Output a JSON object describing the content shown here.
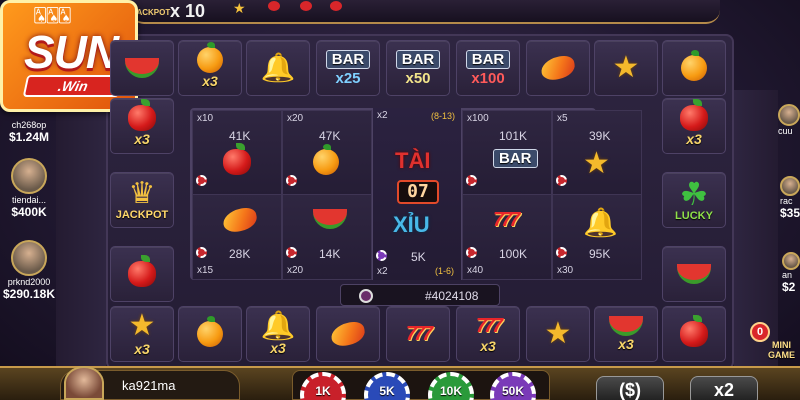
{
  "top": {
    "jackpot_label": "JACKPOT",
    "jackpot_multiplier": "x 10"
  },
  "logo": {
    "brand": "SUN",
    "ribbon": ".Win"
  },
  "board": {
    "top_row": [
      {
        "type": "melon",
        "label": ""
      },
      {
        "type": "orange",
        "label": "x3"
      },
      {
        "type": "bell",
        "label": ""
      },
      {
        "type": "bar",
        "word": "BAR",
        "mult": "x25",
        "mult_color": "#7fd0ff"
      },
      {
        "type": "bar",
        "word": "BAR",
        "mult": "x50",
        "mult_color": "#f2e48a"
      },
      {
        "type": "bar",
        "word": "BAR",
        "mult": "x100",
        "mult_color": "#ff5a5a"
      },
      {
        "type": "mango",
        "label": ""
      },
      {
        "type": "star",
        "label": ""
      },
      {
        "type": "orange",
        "label": ""
      }
    ],
    "bottom_row": [
      {
        "type": "star",
        "label": "x3"
      },
      {
        "type": "orange",
        "label": ""
      },
      {
        "type": "bell",
        "label": "x3"
      },
      {
        "type": "mango",
        "label": ""
      },
      {
        "type": "seven",
        "label": ""
      },
      {
        "type": "seven",
        "label": "x3"
      },
      {
        "type": "star",
        "label": ""
      },
      {
        "type": "melon",
        "label": "x3"
      },
      {
        "type": "apple",
        "label": ""
      }
    ],
    "left_col": [
      {
        "type": "apple",
        "label": "x3"
      },
      {
        "type": "jackpot",
        "label": "JACKPOT"
      },
      {
        "type": "apple",
        "label": ""
      }
    ],
    "right_col": [
      {
        "type": "apple",
        "label": "x3"
      },
      {
        "type": "lucky",
        "label": "LUCKY"
      },
      {
        "type": "melon",
        "label": ""
      }
    ]
  },
  "bets": {
    "top": [
      {
        "mult": "x10",
        "amount": "41K",
        "symbol": "apple"
      },
      {
        "mult": "x20",
        "amount": "47K",
        "symbol": "orange"
      },
      {
        "mult": "x100",
        "amount": "101K",
        "symbol": "bar"
      },
      {
        "mult": "x5",
        "amount": "39K",
        "symbol": "star"
      }
    ],
    "bottom": [
      {
        "mult": "x15",
        "amount": "28K",
        "symbol": "mango"
      },
      {
        "mult": "x20",
        "amount": "14K",
        "symbol": "melon"
      },
      {
        "mult": "x40",
        "amount": "100K",
        "symbol": "seven"
      },
      {
        "mult": "x30",
        "amount": "95K",
        "symbol": "bell"
      }
    ],
    "center": {
      "top_mult": "x2",
      "top_range": "(8-13)",
      "tai": "TÀI",
      "counter": "07",
      "xiu": "XỈU",
      "bottom_amount": "5K",
      "bottom_mult": "x2",
      "bottom_range": "(1-6)"
    },
    "bar_label": "BAR"
  },
  "round": {
    "id": "#4024108"
  },
  "players_left": [
    {
      "name": "ch268op",
      "amount": "$1.24M"
    },
    {
      "name": "tiendai...",
      "amount": "$400K"
    },
    {
      "name": "prknd2000",
      "amount": "$290.18K"
    }
  ],
  "players_right": [
    {
      "name": "cuu",
      "amount": ""
    },
    {
      "name": "rac",
      "amount": "$35"
    },
    {
      "name": "an",
      "amount": "$2"
    }
  ],
  "me": {
    "name": "ka921ma"
  },
  "chips": [
    {
      "label": "1K",
      "color": "#c8202a"
    },
    {
      "label": "5K",
      "color": "#2a4ab8"
    },
    {
      "label": "10K",
      "color": "#2a9a3a"
    },
    {
      "label": "50K",
      "color": "#7a3ab8"
    }
  ],
  "actions": {
    "rebet": "($)",
    "double": "x2"
  },
  "minigame": {
    "badge": "0",
    "label_line1": "MINI",
    "label_line2": "GAME"
  }
}
